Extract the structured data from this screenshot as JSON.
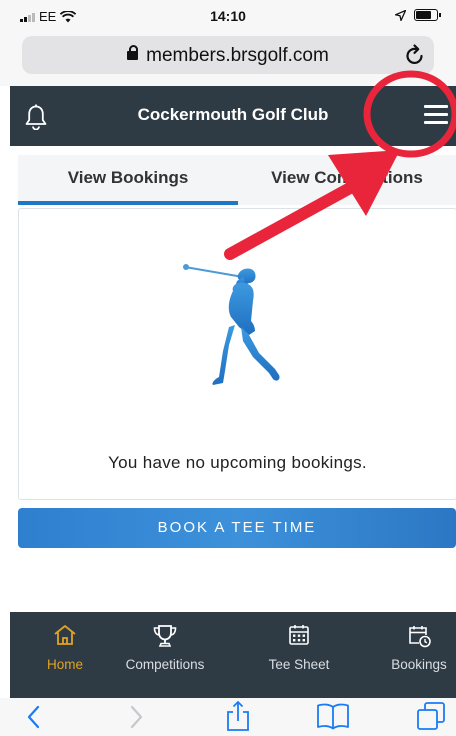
{
  "status_bar": {
    "carrier": "EE",
    "time": "14:10"
  },
  "browser": {
    "url": "members.brsgolf.com"
  },
  "header": {
    "title": "Cockermouth Golf Club",
    "left_icon": "bell-icon",
    "right_icon": "hamburger-menu-icon"
  },
  "tabs": [
    {
      "label": "View Bookings",
      "active": true
    },
    {
      "label": "View Competitions",
      "active": false
    }
  ],
  "bookings": {
    "empty_message": "You have no upcoming bookings."
  },
  "actions": {
    "book_label": "BOOK A TEE TIME"
  },
  "bottom_nav": [
    {
      "label": "Home",
      "icon": "home-icon",
      "active": true
    },
    {
      "label": "Competitions",
      "icon": "trophy-icon",
      "active": false
    },
    {
      "label": "Tee Sheet",
      "icon": "calendar-grid-icon",
      "active": false
    },
    {
      "label": "Bookings",
      "icon": "calendar-clock-icon",
      "active": false
    }
  ],
  "colors": {
    "header_bg": "#2e3a44",
    "accent_blue": "#1d78c8",
    "active_nav": "#e2a322",
    "annotation_red": "#e8253a"
  }
}
